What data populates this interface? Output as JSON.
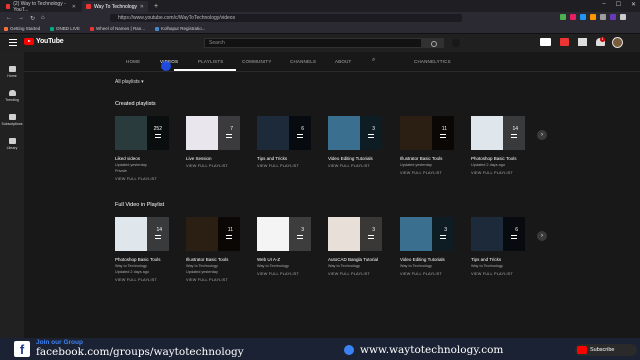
{
  "browser": {
    "tabs": [
      {
        "label": "(2) Way to Technology - YouT...",
        "active": false
      },
      {
        "label": "Way To Technology",
        "active": true
      }
    ],
    "new_tab": "+",
    "url": "https://www.youtube.com/c/WayToTechnology/videos",
    "bookmarks": [
      "Getting Started",
      "DNBD LIVE",
      "Wheel of Names | Ran...",
      "Kolhapur Registratio..."
    ]
  },
  "youtube": {
    "logo_text": "YouTube",
    "search_placeholder": "Search",
    "notification_count": "1",
    "sidebar": [
      {
        "label": "Home",
        "icon": "home-icon"
      },
      {
        "label": "Trending",
        "icon": "flame-icon"
      },
      {
        "label": "Subscriptions",
        "icon": "subscriptions-icon"
      },
      {
        "label": "Library",
        "icon": "library-icon"
      }
    ],
    "channel_tabs": [
      "HOME",
      "VIDEOS",
      "PLAYLISTS",
      "COMMUNITY",
      "CHANNELS",
      "ABOUT",
      "CHANNELYTICS"
    ],
    "active_tab": "VIDEOS",
    "sort_label": "All playlists",
    "sections": [
      {
        "title": "Created playlists",
        "cards": [
          {
            "title": "Liked videos",
            "count": "252",
            "meta1": "Updated yesterday",
            "meta2": "Private",
            "link": "VIEW FULL PLAYLIST",
            "color": "#2a3b3d"
          },
          {
            "title": "Live Session",
            "count": "7",
            "meta1": "",
            "meta2": "",
            "link": "VIEW FULL PLAYLIST",
            "color": "#e9e6ee"
          },
          {
            "title": "Tips and Tricks",
            "count": "6",
            "meta1": "",
            "meta2": "",
            "link": "VIEW FULL PLAYLIST",
            "color": "#1c2a3a"
          },
          {
            "title": "Video Editing Tutorials",
            "count": "3",
            "meta1": "",
            "meta2": "",
            "link": "VIEW FULL PLAYLIST",
            "color": "#3a6f8f"
          },
          {
            "title": "Illustrator Basic Tools",
            "count": "11",
            "meta1": "Updated yesterday",
            "meta2": "",
            "link": "VIEW FULL PLAYLIST",
            "color": "#2a1f12"
          },
          {
            "title": "Photoshop Basic Tools",
            "count": "14",
            "meta1": "Updated 2 days ago",
            "meta2": "",
            "link": "VIEW FULL PLAYLIST",
            "color": "#dfe6ec"
          }
        ]
      },
      {
        "title": "Full Video in Playlist",
        "cards": [
          {
            "title": "Photoshop Basic Tools",
            "count": "14",
            "meta1": "Way to Technology",
            "meta2": "Updated 2 days ago",
            "link": "VIEW FULL PLAYLIST",
            "color": "#dfe6ec"
          },
          {
            "title": "Illustrator Basic Tools",
            "count": "11",
            "meta1": "Way to Technology",
            "meta2": "Updated yesterday",
            "link": "VIEW FULL PLAYLIST",
            "color": "#2a1f12"
          },
          {
            "title": "Web UI A-Z",
            "count": "3",
            "meta1": "Way to Technology",
            "meta2": "",
            "link": "VIEW FULL PLAYLIST",
            "color": "#f4f4f4"
          },
          {
            "title": "AutoCAD Bangla Tutorial",
            "count": "3",
            "meta1": "Way to Technology",
            "meta2": "",
            "link": "VIEW FULL PLAYLIST",
            "color": "#e8e0d8"
          },
          {
            "title": "Video Editing Tutorials",
            "count": "3",
            "meta1": "Way to Technology",
            "meta2": "",
            "link": "VIEW FULL PLAYLIST",
            "color": "#3a6f8f"
          },
          {
            "title": "Tips and Tricks",
            "count": "6",
            "meta1": "Way to Technology",
            "meta2": "",
            "link": "VIEW FULL PLAYLIST",
            "color": "#1c2a3a"
          }
        ]
      }
    ]
  },
  "footer": {
    "join": "Join our Group",
    "fb_url": "facebook.com/groups/waytotechnology",
    "site_url": "www.waytotechnology.com",
    "subscribe": "Subscribe"
  },
  "colors": {
    "accent": "#ff0000",
    "page_bg": "#181818",
    "footer_bg": "#1a2233",
    "link_blue": "#3b82f6"
  }
}
